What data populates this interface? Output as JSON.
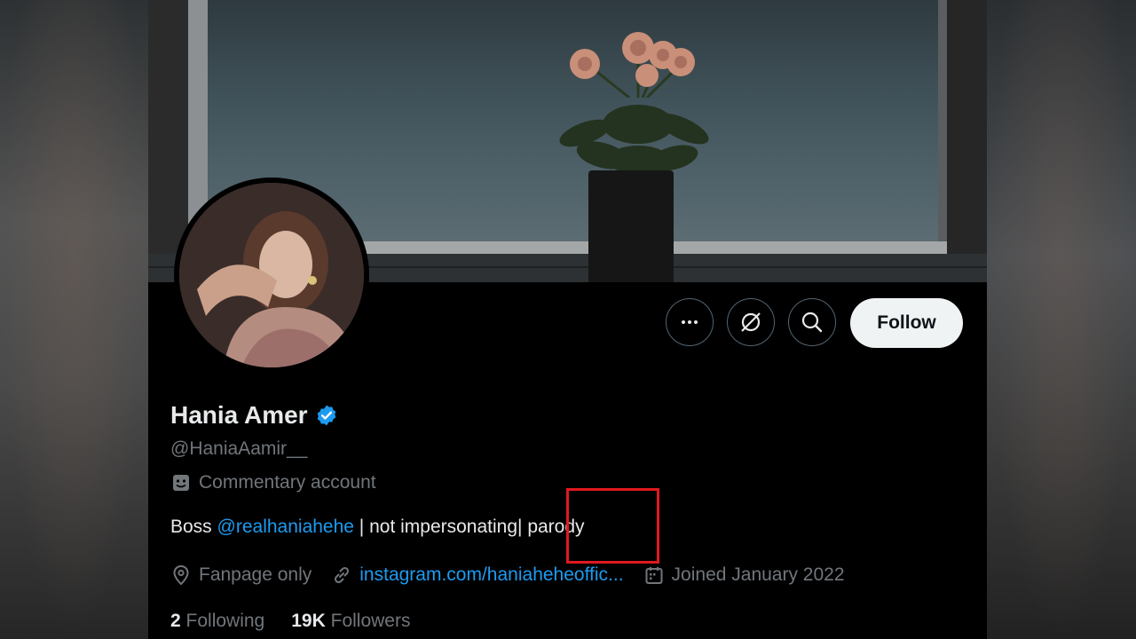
{
  "profile": {
    "display_name": "Hania Amer",
    "handle": "@HaniaAamir__",
    "account_label": "Commentary account",
    "bio_prefix": "Boss ",
    "bio_mention": "@realhaniahehe",
    "bio_middle": " | not impersonating",
    "bio_suffix": "| parody",
    "location": "Fanpage only",
    "website": "instagram.com/haniaheheoffic...",
    "joined": "Joined January 2022",
    "following_count": "2",
    "following_label": "Following",
    "followers_count": "19K",
    "followers_label": "Followers"
  },
  "actions": {
    "follow_label": "Follow"
  },
  "colors": {
    "background": "#000000",
    "link": "#1d9bf0",
    "verified": "#1d9bf0",
    "muted_text": "#71767b",
    "highlight_box": "#e0191f"
  },
  "icons": [
    "more-icon",
    "grok-icon",
    "search-icon",
    "verified-badge-icon",
    "commentary-mask-icon",
    "location-icon",
    "link-icon",
    "calendar-icon"
  ]
}
